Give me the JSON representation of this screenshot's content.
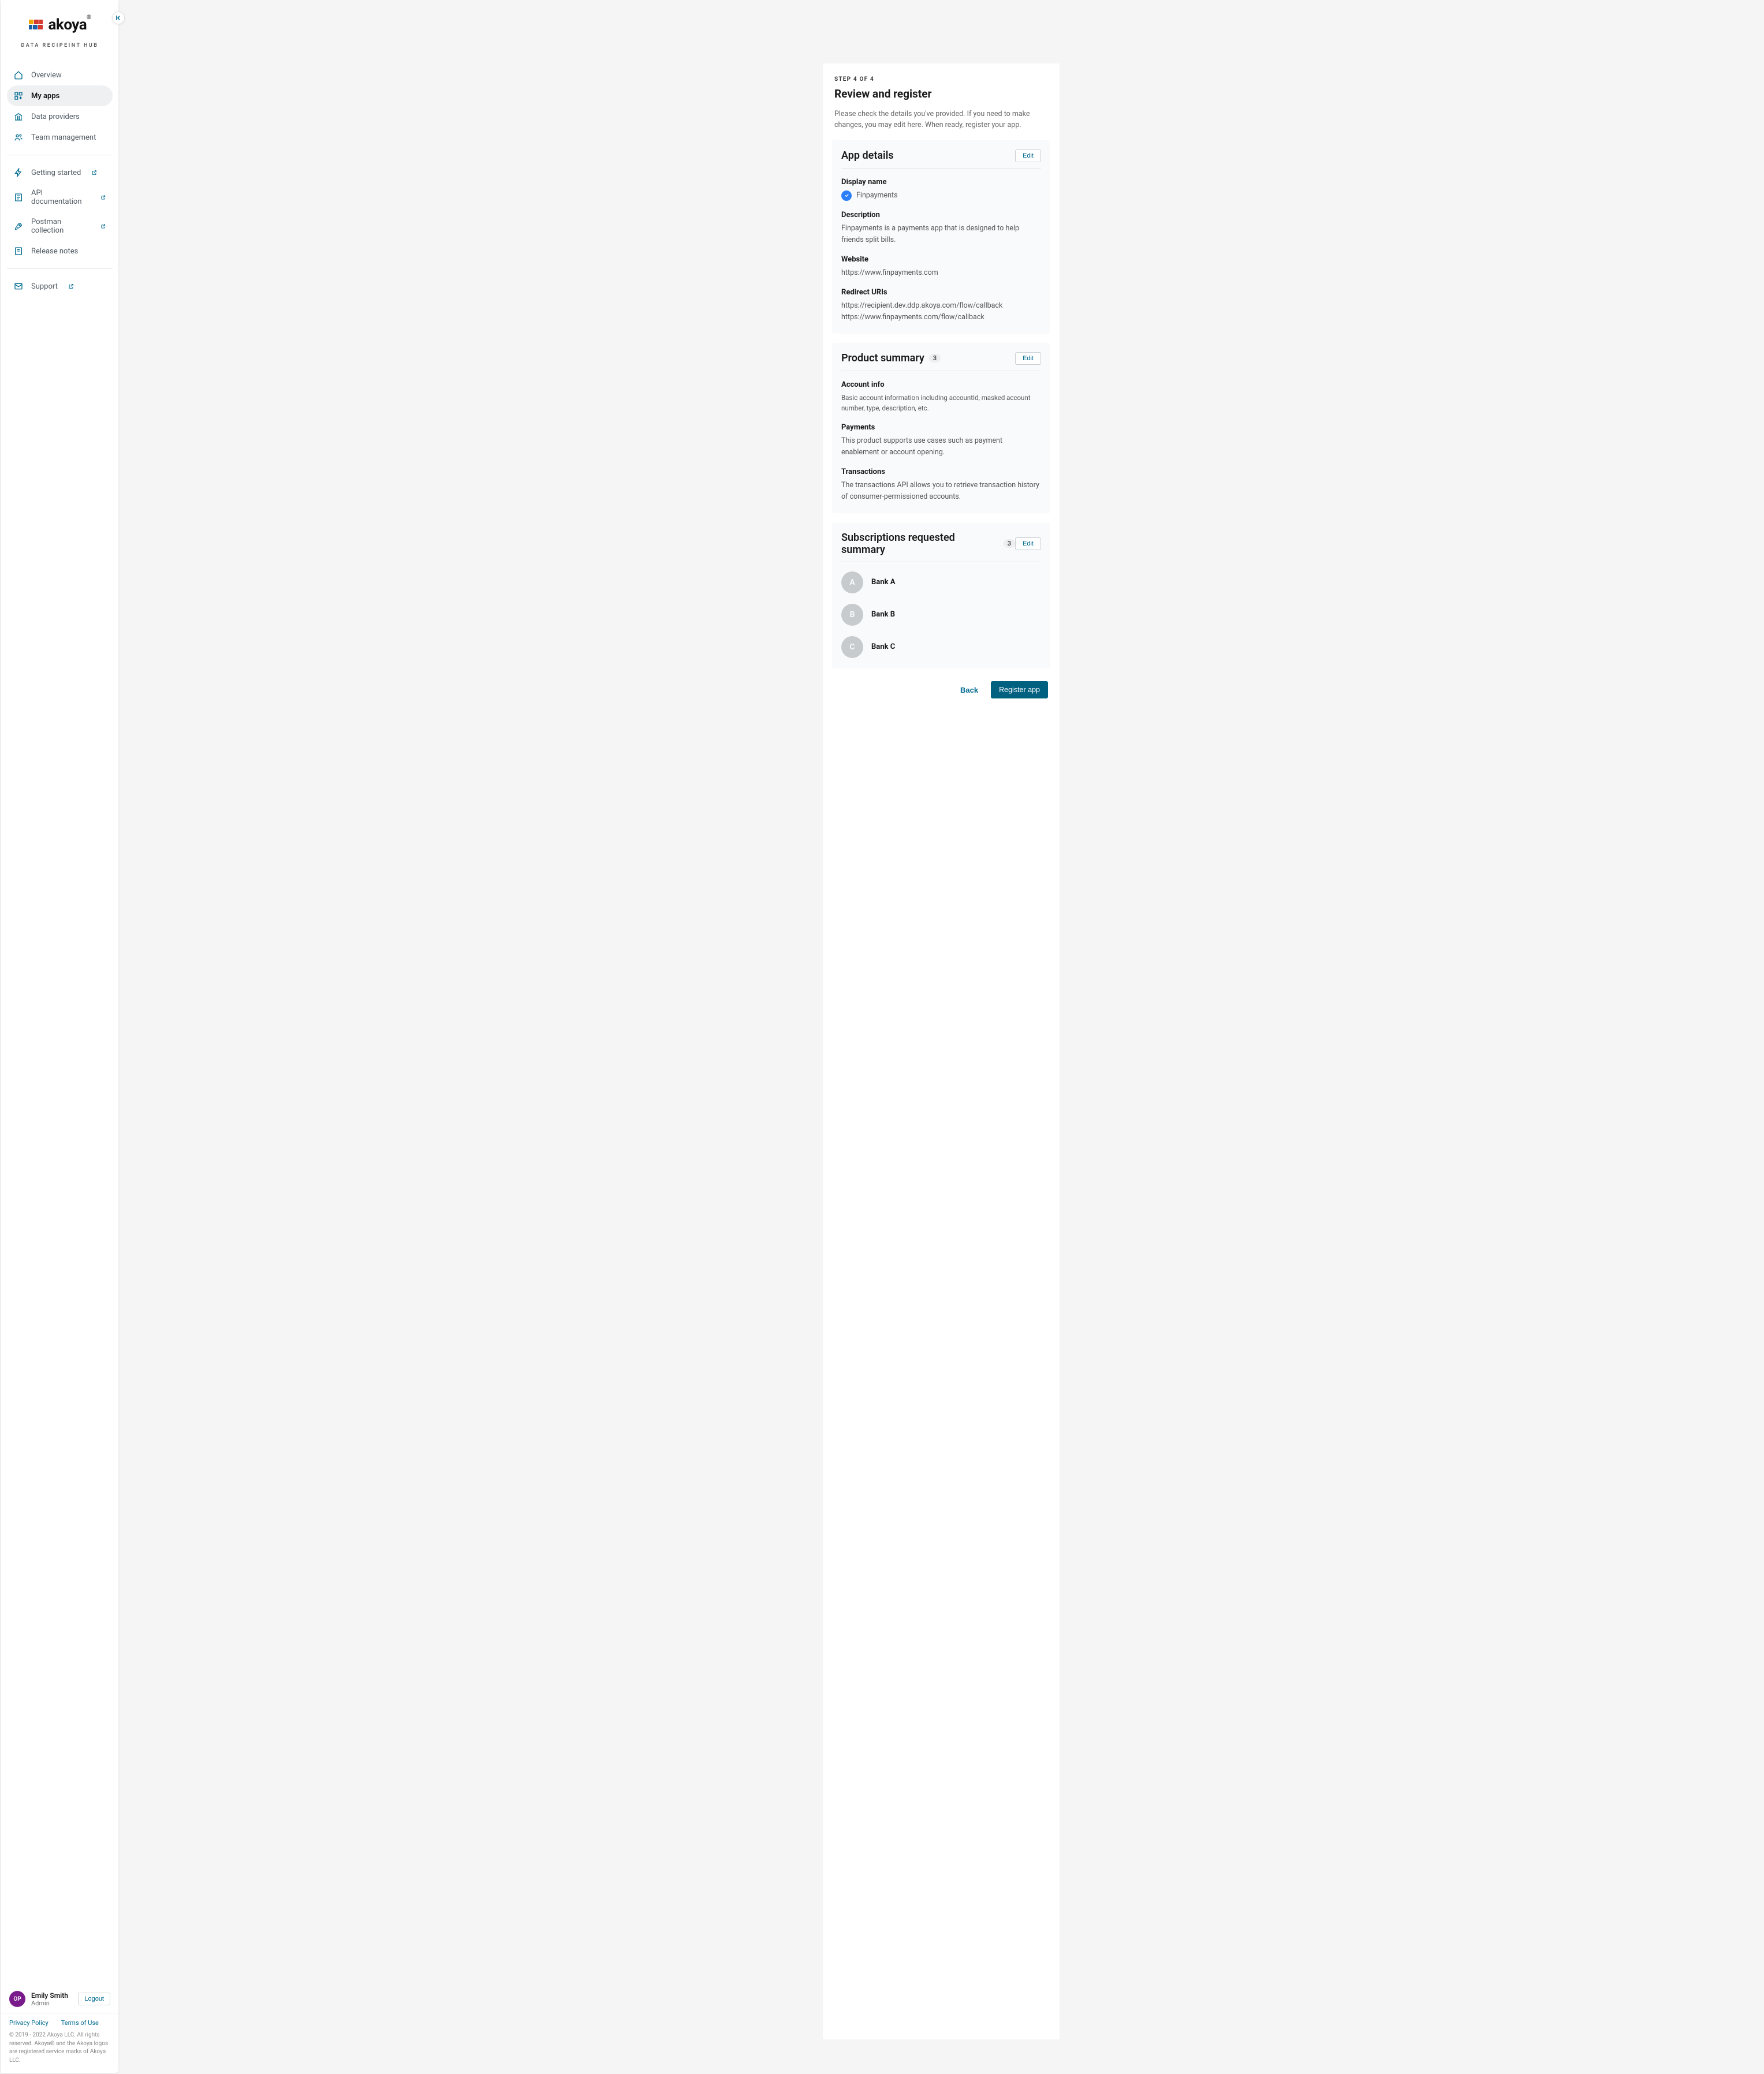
{
  "brand": {
    "name": "akoya",
    "tagline": "DATA RECIPEINT HUB"
  },
  "sidebar": {
    "items": [
      {
        "label": "Overview"
      },
      {
        "label": "My apps"
      },
      {
        "label": "Data providers"
      },
      {
        "label": "Team management"
      }
    ],
    "secondary": [
      {
        "label": "Getting started"
      },
      {
        "label": "API documentation"
      },
      {
        "label": "Postman collection"
      },
      {
        "label": "Release notes"
      }
    ],
    "support_label": "Support"
  },
  "user": {
    "initials": "OP",
    "name": "Emily Smith",
    "role": "Admin",
    "logout_label": "Logout"
  },
  "legal": {
    "privacy": "Privacy Policy",
    "terms": "Terms of Use",
    "copyright": "© 2019 - 2022 Akoya LLC. All rights reserved. Akoya® and the Akoya logos are registered service marks of Akoya LLC."
  },
  "page": {
    "step": "STEP 4 OF 4",
    "title": "Review and register",
    "intro": "Please check the details you've provided. If you need to make changes, you may edit here. When ready, register your app."
  },
  "app_details": {
    "section_title": "App details",
    "edit_label": "Edit",
    "display_name_label": "Display name",
    "display_name_value": "Finpayments",
    "description_label": "Description",
    "description_value": "Finpayments is a payments app that is designed to help friends split bills.",
    "website_label": "Website",
    "website_value": "https://www.finpayments.com",
    "redirect_label": "Redirect URIs",
    "redirect_values": [
      "https://recipient.dev.ddp.akoya.com/flow/callback",
      "https://www.finpayments.com/flow/callback"
    ]
  },
  "product_summary": {
    "section_title": "Product summary",
    "count": "3",
    "edit_label": "Edit",
    "items": [
      {
        "title": "Account info",
        "desc": "Basic account information including accountId, masked account number, type, description, etc."
      },
      {
        "title": "Payments",
        "desc": "This product supports use cases such as payment enablement or account opening."
      },
      {
        "title": "Transactions",
        "desc": "The transactions API allows you to retrieve transaction history of consumer-permissioned accounts."
      }
    ]
  },
  "subscriptions": {
    "section_title": "Subscriptions requested summary",
    "count": "3",
    "edit_label": "Edit",
    "items": [
      {
        "initial": "A",
        "name": "Bank A"
      },
      {
        "initial": "B",
        "name": "Bank B"
      },
      {
        "initial": "C",
        "name": "Bank C"
      }
    ]
  },
  "actions": {
    "back": "Back",
    "register": "Register app"
  }
}
